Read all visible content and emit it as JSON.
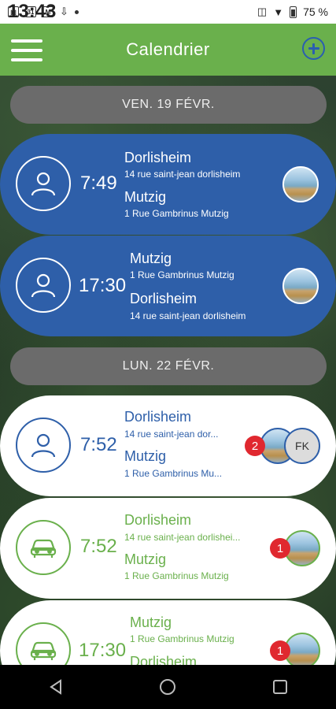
{
  "status_bar": {
    "time": "13:43",
    "calendar_day": "31",
    "battery": "75 %"
  },
  "app_bar": {
    "title": "Calendrier"
  },
  "sections": [
    {
      "date": "VEN. 19 FÉVR.",
      "rides": [
        {
          "style": "blue",
          "icon": "person-icon",
          "time": "7:49",
          "from_name": "Dorlisheim",
          "from_addr": "14 rue saint-jean dorlisheim",
          "to_name": "Mutzig",
          "to_addr": "1 Rue Gambrinus Mutzig"
        },
        {
          "style": "blue",
          "icon": "person-icon",
          "time": "17:30",
          "from_name": "Mutzig",
          "from_addr": "1 Rue Gambrinus Mutzig",
          "to_name": "Dorlisheim",
          "to_addr": "14 rue saint-jean dorlisheim"
        }
      ]
    },
    {
      "date": "LUN. 22 FÉVR.",
      "rides": [
        {
          "style": "white-blue",
          "icon": "person-icon",
          "time": "7:52",
          "from_name": "Dorlisheim",
          "from_addr": "14 rue saint-jean dor...",
          "to_name": "Mutzig",
          "to_addr": "1 Rue Gambrinus Mu...",
          "badge": "2",
          "extra_avatar": "FK"
        },
        {
          "style": "white-green",
          "icon": "car-icon",
          "time": "7:52",
          "from_name": "Dorlisheim",
          "from_addr": "14 rue saint-jean dorlishei...",
          "to_name": "Mutzig",
          "to_addr": "1 Rue Gambrinus Mutzig",
          "badge": "1"
        },
        {
          "style": "white-green",
          "icon": "car-icon",
          "time": "17:30",
          "from_name": "Mutzig",
          "from_addr": "1 Rue Gambrinus Mutzig",
          "to_name": "Dorlisheim",
          "to_addr": "",
          "badge": "1"
        }
      ]
    }
  ],
  "colors": {
    "accent_green": "#6ab04c",
    "primary_blue": "#2e5fa9",
    "badge_red": "#e0282f",
    "header_gray": "#6b6b6b"
  }
}
